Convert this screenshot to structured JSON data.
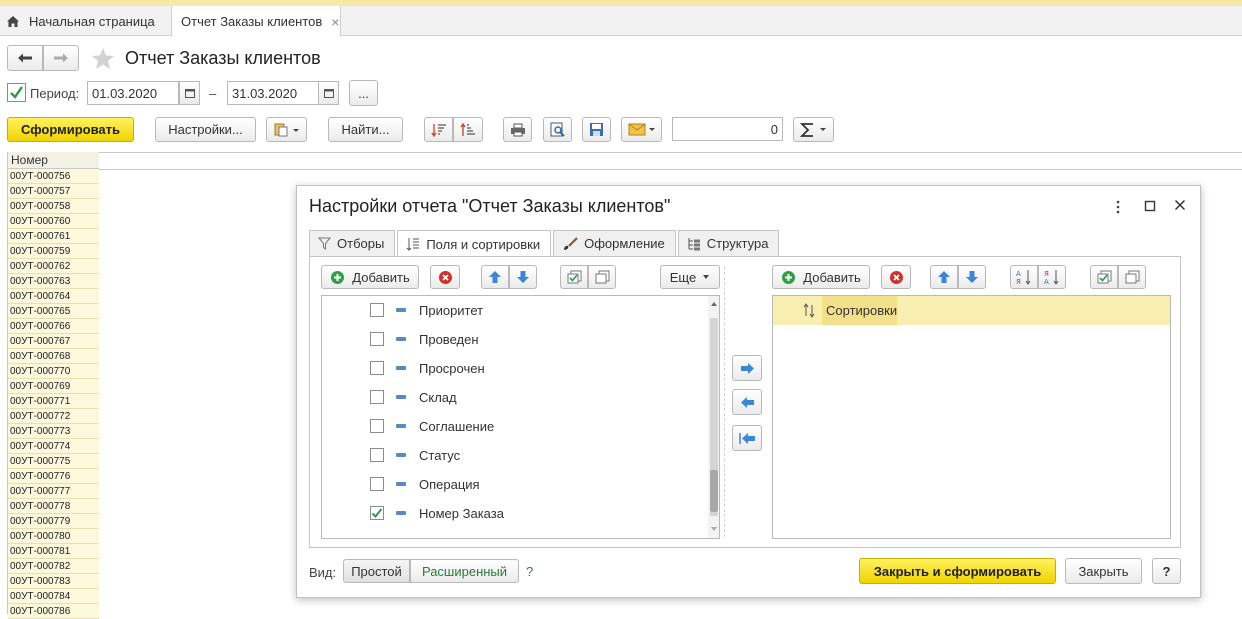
{
  "tabs": {
    "home": "Начальная страница",
    "report": "Отчет Заказы клиентов",
    "close": "×"
  },
  "page": {
    "title": "Отчет Заказы клиентов"
  },
  "period": {
    "label": "Период:",
    "from": "01.03.2020",
    "separator": "–",
    "to": "31.03.2020",
    "more": "..."
  },
  "toolbar": {
    "generate": "Сформировать",
    "settings": "Настройки...",
    "find": "Найти...",
    "sum_value": "0"
  },
  "left_table": {
    "header": "Номер",
    "rows": [
      "00УТ-000756",
      "00УТ-000757",
      "00УТ-000758",
      "00УТ-000760",
      "00УТ-000761",
      "00УТ-000759",
      "00УТ-000762",
      "00УТ-000763",
      "00УТ-000764",
      "00УТ-000765",
      "00УТ-000766",
      "00УТ-000767",
      "00УТ-000768",
      "00УТ-000770",
      "00УТ-000769",
      "00УТ-000771",
      "00УТ-000772",
      "00УТ-000773",
      "00УТ-000774",
      "00УТ-000775",
      "00УТ-000776",
      "00УТ-000777",
      "00УТ-000778",
      "00УТ-000779",
      "00УТ-000780",
      "00УТ-000781",
      "00УТ-000782",
      "00УТ-000783",
      "00УТ-000784",
      "00УТ-000786"
    ]
  },
  "dialog": {
    "title": "Настройки отчета \"Отчет Заказы клиентов\"",
    "tabs": [
      "Отборы",
      "Поля и сортировки",
      "Оформление",
      "Структура"
    ],
    "add": "Добавить",
    "more": "Еще",
    "fields": [
      {
        "label": "Приоритет",
        "checked": false
      },
      {
        "label": "Проведен",
        "checked": false
      },
      {
        "label": "Просрочен",
        "checked": false
      },
      {
        "label": "Склад",
        "checked": false
      },
      {
        "label": "Соглашение",
        "checked": false
      },
      {
        "label": "Статус",
        "checked": false
      },
      {
        "label": "Операция",
        "checked": false
      },
      {
        "label": "Номер Заказа",
        "checked": true
      }
    ],
    "sort_root": "Сортировки",
    "view_label": "Вид:",
    "view_simple": "Простой",
    "view_extended": "Расширенный",
    "help": "?",
    "close_and_generate": "Закрыть и сформировать",
    "close": "Закрыть",
    "help_button": "?"
  },
  "colors": {
    "accent_yellow": "#f5dc00",
    "selected_row": "#f8eeb0",
    "arrow_blue": "#3a86d8",
    "delete_red": "#d0312d",
    "add_green": "#2ea043"
  }
}
